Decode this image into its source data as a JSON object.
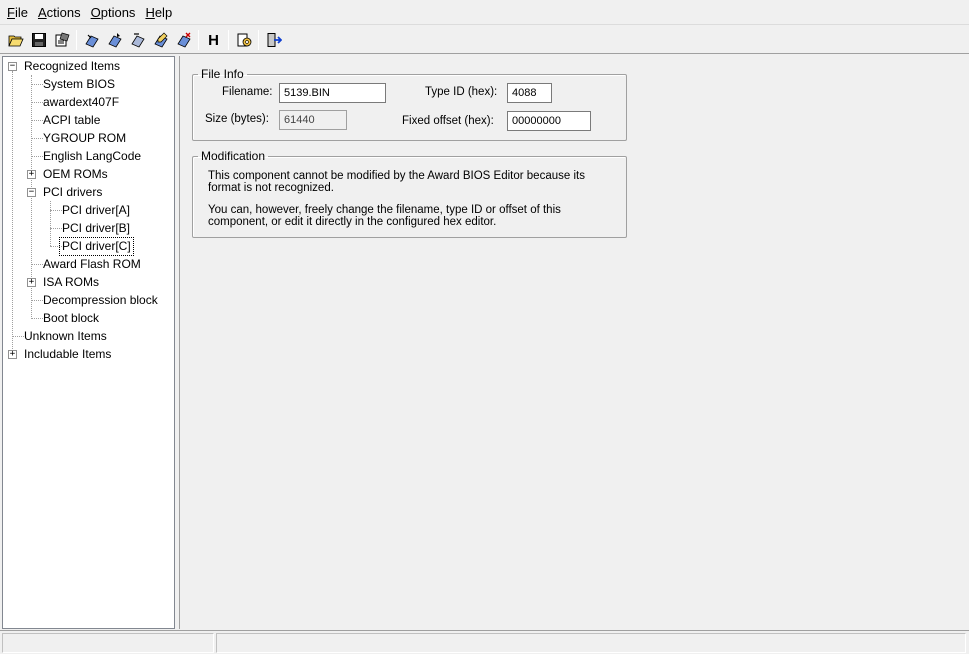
{
  "menu": {
    "file": {
      "acc": "F",
      "rest": "ile"
    },
    "actions": {
      "acc": "A",
      "rest": "ctions"
    },
    "options": {
      "acc": "O",
      "rest": "ptions"
    },
    "help": {
      "acc": "H",
      "rest": "elp"
    }
  },
  "toolbar": {
    "icons": [
      "open-folder-icon",
      "save-icon",
      "properties-icon",
      "insert-icon",
      "extract-icon",
      "replace-icon",
      "edit-icon",
      "remove-icon",
      "hex-edit-icon",
      "settings-icon",
      "exit-icon"
    ],
    "hex_label": "H"
  },
  "tree": {
    "recognized": "Recognized Items",
    "system_bios": "System BIOS",
    "awardext": "awardext407F",
    "acpi": "ACPI table",
    "ygroup": "YGROUP ROM",
    "english": "English LangCode",
    "oem": "OEM ROMs",
    "pci": "PCI drivers",
    "pci_a": "PCI driver[A]",
    "pci_b": "PCI driver[B]",
    "pci_c": "PCI driver[C]",
    "award_flash": "Award Flash ROM",
    "isa": "ISA ROMs",
    "decomp": "Decompression block",
    "boot": "Boot block",
    "unknown": "Unknown Items",
    "includable": "Includable Items",
    "collapse_sign": "−",
    "expand_sign": "+"
  },
  "file_info": {
    "legend": "File Info",
    "filename_label": "Filename:",
    "filename_value": "5139.BIN",
    "typeid_label": "Type ID (hex):",
    "typeid_value": "4088",
    "size_label": "Size (bytes):",
    "size_value": "61440",
    "offset_label": "Fixed offset (hex):",
    "offset_value": "00000000"
  },
  "modification": {
    "legend": "Modification",
    "line1": "This component cannot be modified by the Award BIOS Editor because its",
    "line2": "format is not recognized.",
    "line3": "You can, however, freely change the filename, type ID or offset of this",
    "line4": "component, or edit it directly in the configured hex editor."
  }
}
